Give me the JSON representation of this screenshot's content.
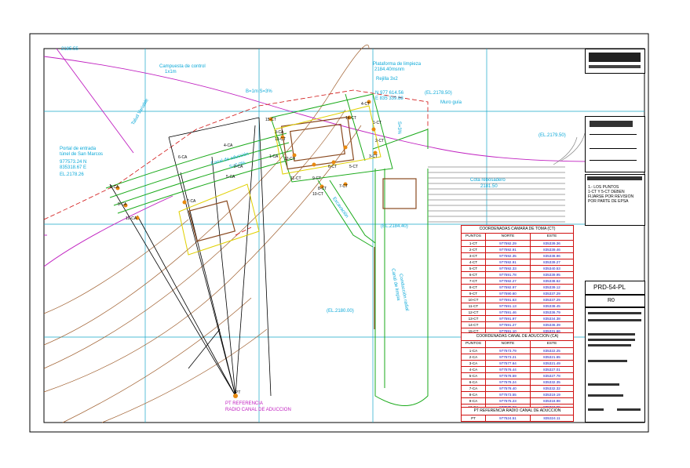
{
  "labels": {
    "top_left_elev": "2185.55",
    "campuesta": "Campuesta de control",
    "campuesta_dim": "1x1m",
    "plataforma": "Plataforma de limpieza",
    "plataforma_elev": "2184.40msnm",
    "rejilla": "Rejilla 3x2",
    "coord_n": "N 977 614.56",
    "coord_e": "E 835 339.88",
    "b_s": "B=1m S=3%",
    "el_2178": "(EL.2178.50)",
    "muro_guia": "Muro guía",
    "talud": "Talud Variable",
    "el_2179": "(EL.2179.50)",
    "s3": "S=3%",
    "portal_title": "Portal de entrada",
    "portal_sub": "túnel de San Marcos",
    "portal_n": "977573.24 N",
    "portal_e": "835318.67 E",
    "portal_el": "EL.2178.26",
    "canal": "Canal de aducción",
    "canal_s": "S=0.0%",
    "rebosadero": "Cota rebosadero",
    "rebosadero_el": "2181.50",
    "el_2184": "(EL.2184.40)",
    "el_2180": "(EL.2180.00)",
    "excav": "Excavación",
    "conduccion": "Conducción radial",
    "conduccion2": "Canal de limpia",
    "pt_ref": "PT REFERENCIA",
    "pt_radio": "RADIO CANAL DE ADUCCION",
    "pt_a": "PT",
    "note_title": "1.- LOS PUNTOS",
    "note_l2": "1-CT Y 5-CT DEBEN",
    "note_l3": "FIJARSE POR REVISION",
    "note_l4": "POR PARTE DE EPSA",
    "drawing_no": "PRD-54-PL",
    "rev": "R0",
    "point_labels": [
      "1-CT",
      "2-CT",
      "3-CT",
      "4-CT",
      "5-CT",
      "6-CT",
      "7-CT",
      "8-CT",
      "9-CT",
      "10-CT",
      "11-CT",
      "12-CT",
      "13-CT",
      "14-CT",
      "15-CT",
      "1-CA",
      "2-CA",
      "3-CA",
      "4-CA",
      "5-CA",
      "6-CA",
      "7-CA",
      "8-CA",
      "9-CA",
      "10-CA"
    ]
  },
  "table_ct": {
    "title": "COORDENADAS CAMARA DE TOMA (CT)",
    "cols": [
      "PUNTOS",
      "NORTE",
      "ESTE"
    ],
    "rows": [
      [
        "1-CT",
        "977592.29",
        "835339.36"
      ],
      [
        "2-CT",
        "977592.91",
        "835339.46"
      ],
      [
        "3-CT",
        "977592.35",
        "835338.96"
      ],
      [
        "4-CT",
        "977592.91",
        "835339.27"
      ],
      [
        "5-CT",
        "977592.33",
        "835340.53"
      ],
      [
        "6-CT",
        "977591.78",
        "835339.95"
      ],
      [
        "7-CT",
        "977592.27",
        "835338.62"
      ],
      [
        "8-CT",
        "977592.97",
        "835339.12"
      ],
      [
        "9-CT",
        "977590.60",
        "835337.29"
      ],
      [
        "10-CT",
        "977591.63",
        "835337.29"
      ],
      [
        "11-CT",
        "977591.13",
        "835338.45"
      ],
      [
        "12-CT",
        "977591.46",
        "835336.79"
      ],
      [
        "13-CT",
        "977591.97",
        "835334.38"
      ],
      [
        "14-CT",
        "977591.27",
        "835336.39"
      ],
      [
        "15-CT",
        "977591.10",
        "835331.66"
      ]
    ]
  },
  "table_ca": {
    "title": "COORDENADAS CANAL DE ADUCCION (CA)",
    "cols": [
      "PUNTOS",
      "NORTE",
      "ESTE"
    ],
    "rows": [
      [
        "1-CA",
        "977573.79",
        "835322.25"
      ],
      [
        "2-CA",
        "977573.21",
        "835321.65"
      ],
      [
        "3-CA",
        "977577.64",
        "835321.49"
      ],
      [
        "4-CA",
        "977576.44",
        "835327.01"
      ],
      [
        "5-CA",
        "977578.59",
        "835327.78"
      ],
      [
        "6-CA",
        "977578.24",
        "835332.35"
      ],
      [
        "7-CA",
        "977578.40",
        "835332.32"
      ],
      [
        "8-CA",
        "977573.55",
        "835319.19"
      ],
      [
        "9-CA",
        "977575.23",
        "835318.98"
      ],
      [
        "10-CA",
        "977575.93",
        "835319.55"
      ]
    ]
  },
  "table_pt": {
    "title": "PT REFERENCIA RADIO CANAL DE ADUCCION",
    "rows": [
      [
        "PT",
        "977524.51",
        "835324.11"
      ]
    ]
  },
  "colors": {
    "grid": "#18a8c8",
    "cyan_text": "#0aa8d8",
    "structure": "#1aaa1a",
    "red": "#d01010",
    "magenta": "#c020c0",
    "brown": "#8a4a20",
    "yellow": "#e0d000",
    "blue": "#1010c0",
    "orange": "#e88a10"
  }
}
